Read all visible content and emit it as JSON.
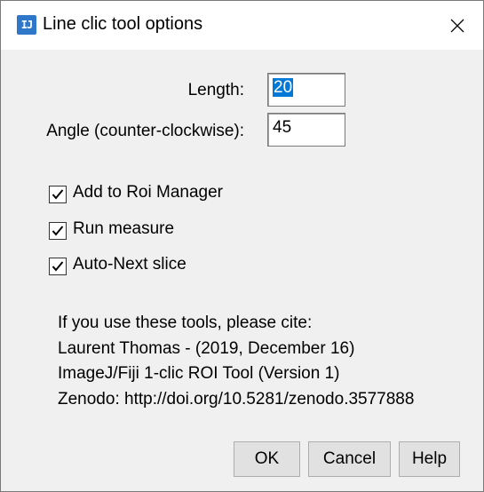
{
  "window": {
    "title": "Line clic tool options",
    "app_icon_text": "IJ"
  },
  "form": {
    "length": {
      "label": "Length:",
      "value": "20"
    },
    "angle": {
      "label": "Angle (counter-clockwise):",
      "value": "45"
    }
  },
  "options": [
    {
      "label": "Add to Roi Manager",
      "checked": true
    },
    {
      "label": "Run measure",
      "checked": true
    },
    {
      "label": "Auto-Next slice",
      "checked": true
    }
  ],
  "citation": [
    "If you use these tools, please cite:",
    "Laurent Thomas - (2019, December 16)",
    "ImageJ/Fiji 1-clic ROI Tool (Version 1)",
    "Zenodo: http://doi.org/10.5281/zenodo.3577888"
  ],
  "buttons": {
    "ok": "OK",
    "cancel": "Cancel",
    "help": "Help"
  },
  "colors": {
    "selection": "#0078d7",
    "icon_blue": "#2f77c8"
  }
}
